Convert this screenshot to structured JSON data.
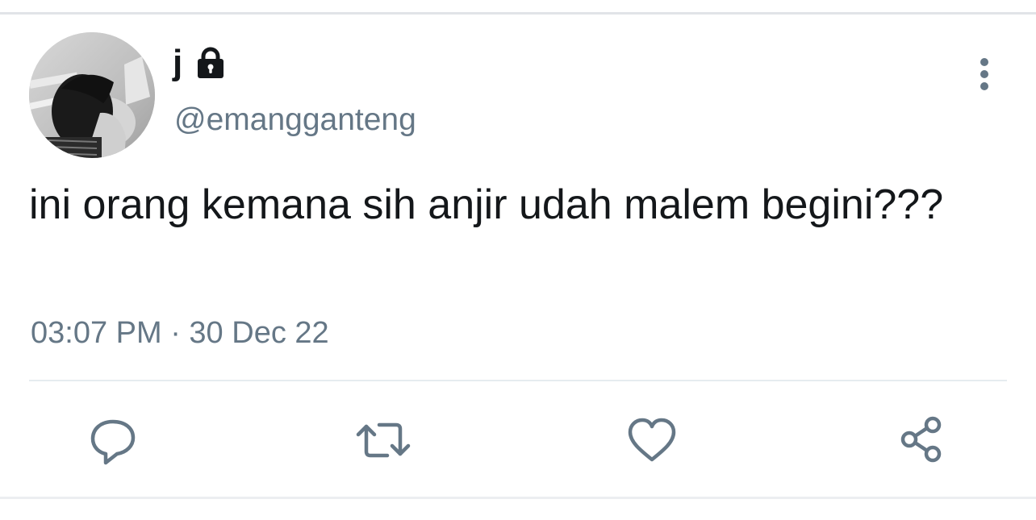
{
  "tweet": {
    "author": {
      "display_name": "j",
      "handle": "@emangganteng",
      "protected_icon": "lock-icon"
    },
    "text": "ini orang kemana sih anjir udah malem begini???",
    "timestamp": "03:07 PM · 30 Dec 22"
  },
  "actions": {
    "reply": "reply-icon",
    "retweet": "retweet-icon",
    "like": "heart-icon",
    "share": "share-icon",
    "more": "more-vertical-icon"
  },
  "colors": {
    "text_primary": "#14171a",
    "text_secondary": "#657786",
    "icon": "#657786",
    "divider": "#e6ecf0"
  }
}
